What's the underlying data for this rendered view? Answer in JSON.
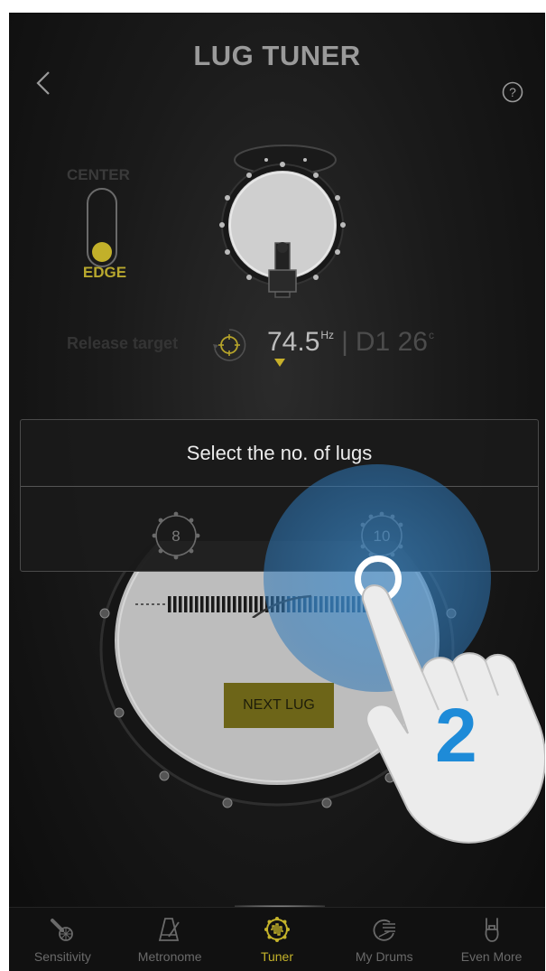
{
  "header": {
    "title": "LUG TUNER"
  },
  "toggle": {
    "center_label": "CENTER",
    "edge_label": "EDGE",
    "selected": "EDGE"
  },
  "readout": {
    "release_label": "Release target",
    "frequency": "74.5",
    "freq_unit": "Hz",
    "separator": "|",
    "note": "D1",
    "cents": "26",
    "cents_unit": "c"
  },
  "dialog": {
    "title": "Select the no. of lugs",
    "options": [
      "8",
      "10"
    ]
  },
  "main": {
    "next_lug_label": "NEXT LUG"
  },
  "overlay": {
    "step_number": "2"
  },
  "tabs": [
    {
      "label": "Sensitivity",
      "icon": "microphone-icon",
      "active": false
    },
    {
      "label": "Metronome",
      "icon": "metronome-icon",
      "active": false
    },
    {
      "label": "Tuner",
      "icon": "tuner-icon",
      "active": true
    },
    {
      "label": "My Drums",
      "icon": "drum-icon",
      "active": false
    },
    {
      "label": "Even More",
      "icon": "rock-hand-icon",
      "active": false
    }
  ],
  "colors": {
    "accent": "#c4b32a",
    "touch": "#3a8acb",
    "step": "#1e8bd8"
  }
}
